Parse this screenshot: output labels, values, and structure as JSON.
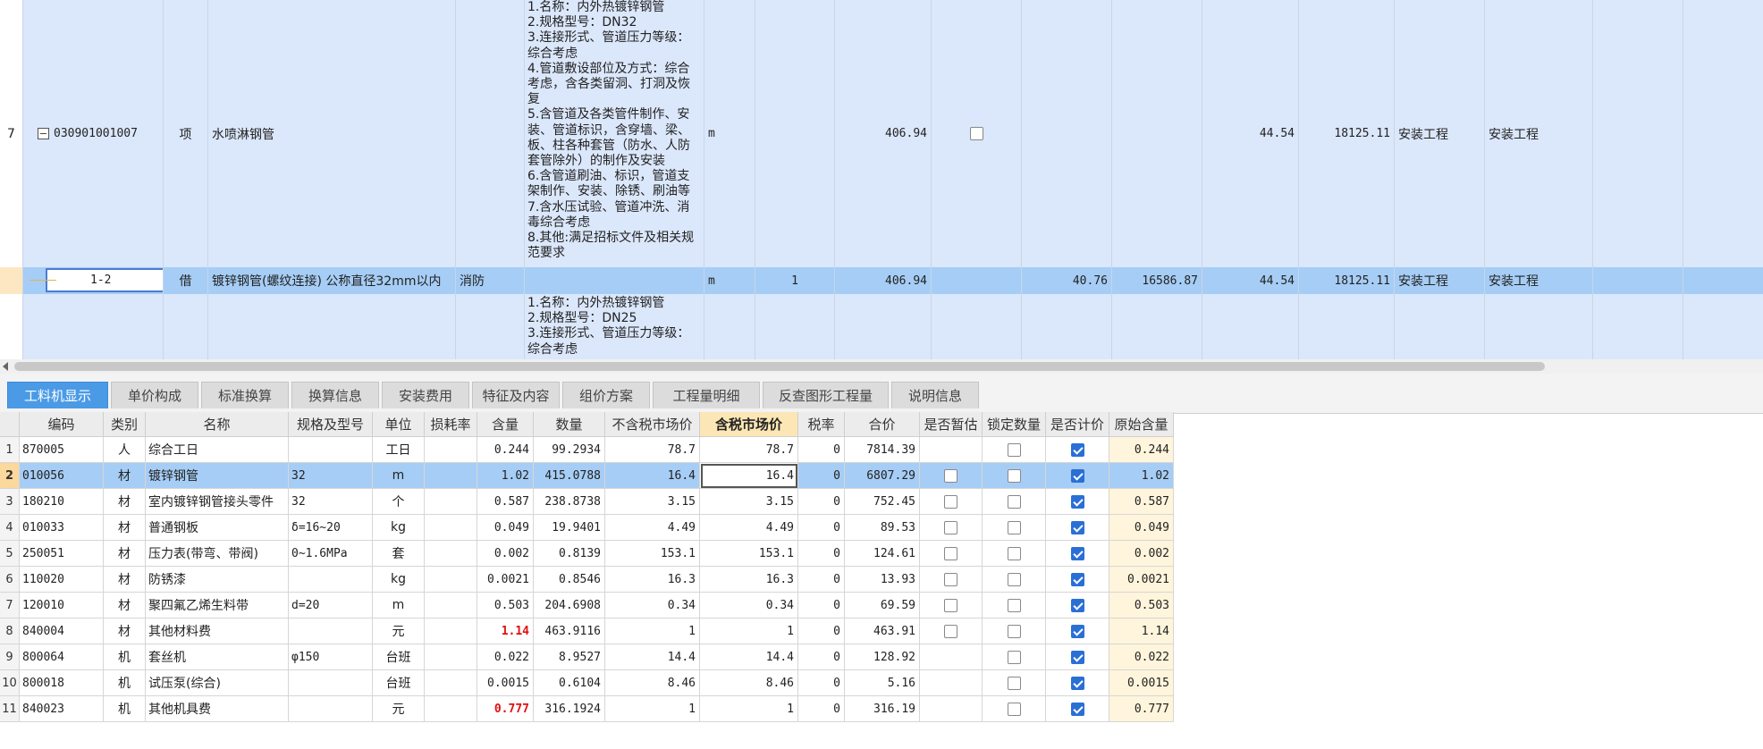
{
  "upper_grid": {
    "rows": [
      {
        "id": "r7",
        "row_number": "7",
        "code": "030901001007",
        "type": "项",
        "name": "水喷淋钢管",
        "specialty": "",
        "description": [
          "1.名称：内外热镀锌钢管",
          "2.规格型号：DN32",
          "3.连接形式、管道压力等级：综合考虑",
          "4.管道敷设部位及方式：综合考虑，含各类留洞、打洞及恢复",
          "5.含管道及各类管件制作、安装、管道标识，含穿墙、梁、板、柱各种套管（防水、人防套管除外）的制作及安装",
          "6.含管道刷油、标识，管道支架制作、安装、除锈、刷油等",
          "7.含水压试验、管道冲洗、消毒综合考虑",
          "8.其他:满足招标文件及相关规范要求"
        ],
        "unit": "m",
        "coef": "",
        "qty": "406.94",
        "checkbox": false,
        "unit_price": "",
        "total": "",
        "unit_price2": "44.54",
        "total2": "18125.11",
        "category1": "安装工程",
        "category2": "安装工程"
      },
      {
        "id": "r12",
        "row_number": "",
        "code": "1-2",
        "type": "借",
        "name": "镀锌钢管(螺纹连接) 公称直径32mm以内",
        "specialty": "消防",
        "description": [],
        "unit": "m",
        "coef": "1",
        "qty": "406.94",
        "unit_price": "40.76",
        "total": "16586.87",
        "unit_price2": "44.54",
        "total2": "18125.11",
        "category1": "安装工程",
        "category2": "安装工程"
      },
      {
        "id": "r8",
        "row_number": "",
        "code": "",
        "type": "",
        "name": "",
        "specialty": "",
        "description": [
          "1.名称：内外热镀锌钢管",
          "2.规格型号：DN25",
          "3.连接形式、管道压力等级：综合考虑"
        ]
      }
    ]
  },
  "tabs": [
    "工料机显示",
    "单价构成",
    "标准换算",
    "换算信息",
    "安装费用",
    "特征及内容",
    "组价方案",
    "工程量明细",
    "反查图形工程量",
    "说明信息"
  ],
  "active_tab": 0,
  "lower_table": {
    "headers": [
      "",
      "编码",
      "类别",
      "名称",
      "规格及型号",
      "单位",
      "损耗率",
      "含量",
      "数量",
      "不含税市场价",
      "含税市场价",
      "税率",
      "合价",
      "是否暂估",
      "锁定数量",
      "是否计价",
      "原始含量"
    ],
    "rows": [
      {
        "n": "1",
        "code": "870005",
        "cat": "人",
        "name": "综合工日",
        "spec": "",
        "unit": "工日",
        "loss": "",
        "content": "0.244",
        "content_red": false,
        "qty": "99.2934",
        "price_ex": "78.7",
        "price_inc": "78.7",
        "tax": "0",
        "total": "7814.39",
        "provisional": null,
        "locked": false,
        "priced": true,
        "orig": "0.244"
      },
      {
        "n": "2",
        "code": "010056",
        "cat": "材",
        "name": "镀锌钢管",
        "spec": "32",
        "unit": "m",
        "loss": "",
        "content": "1.02",
        "content_red": false,
        "qty": "415.0788",
        "price_ex": "16.4",
        "price_inc": "16.4",
        "tax": "0",
        "total": "6807.29",
        "provisional": false,
        "locked": false,
        "priced": true,
        "orig": "1.02",
        "selected": true
      },
      {
        "n": "3",
        "code": "180210",
        "cat": "材",
        "name": "室内镀锌钢管接头零件",
        "spec": "32",
        "unit": "个",
        "loss": "",
        "content": "0.587",
        "content_red": false,
        "qty": "238.8738",
        "price_ex": "3.15",
        "price_inc": "3.15",
        "tax": "0",
        "total": "752.45",
        "provisional": false,
        "locked": false,
        "priced": true,
        "orig": "0.587"
      },
      {
        "n": "4",
        "code": "010033",
        "cat": "材",
        "name": "普通钢板",
        "spec": "δ=16~20",
        "unit": "kg",
        "loss": "",
        "content": "0.049",
        "content_red": false,
        "qty": "19.9401",
        "price_ex": "4.49",
        "price_inc": "4.49",
        "tax": "0",
        "total": "89.53",
        "provisional": false,
        "locked": false,
        "priced": true,
        "orig": "0.049"
      },
      {
        "n": "5",
        "code": "250051",
        "cat": "材",
        "name": "压力表(带弯、带阀)",
        "spec": "0~1.6MPa",
        "unit": "套",
        "loss": "",
        "content": "0.002",
        "content_red": false,
        "qty": "0.8139",
        "price_ex": "153.1",
        "price_inc": "153.1",
        "tax": "0",
        "total": "124.61",
        "provisional": false,
        "locked": false,
        "priced": true,
        "orig": "0.002"
      },
      {
        "n": "6",
        "code": "110020",
        "cat": "材",
        "name": "防锈漆",
        "spec": "",
        "unit": "kg",
        "loss": "",
        "content": "0.0021",
        "content_red": false,
        "qty": "0.8546",
        "price_ex": "16.3",
        "price_inc": "16.3",
        "tax": "0",
        "total": "13.93",
        "provisional": false,
        "locked": false,
        "priced": true,
        "orig": "0.0021"
      },
      {
        "n": "7",
        "code": "120010",
        "cat": "材",
        "name": "聚四氟乙烯生料带",
        "spec": "d=20",
        "unit": "m",
        "loss": "",
        "content": "0.503",
        "content_red": false,
        "qty": "204.6908",
        "price_ex": "0.34",
        "price_inc": "0.34",
        "tax": "0",
        "total": "69.59",
        "provisional": false,
        "locked": false,
        "priced": true,
        "orig": "0.503"
      },
      {
        "n": "8",
        "code": "840004",
        "cat": "材",
        "name": "其他材料费",
        "spec": "",
        "unit": "元",
        "loss": "",
        "content": "1.14",
        "content_red": true,
        "qty": "463.9116",
        "price_ex": "1",
        "price_inc": "1",
        "tax": "0",
        "total": "463.91",
        "provisional": false,
        "locked": false,
        "priced": true,
        "orig": "1.14"
      },
      {
        "n": "9",
        "code": "800064",
        "cat": "机",
        "name": "套丝机",
        "spec": "φ150",
        "unit": "台班",
        "loss": "",
        "content": "0.022",
        "content_red": false,
        "qty": "8.9527",
        "price_ex": "14.4",
        "price_inc": "14.4",
        "tax": "0",
        "total": "128.92",
        "provisional": null,
        "locked": false,
        "priced": true,
        "orig": "0.022"
      },
      {
        "n": "10",
        "code": "800018",
        "cat": "机",
        "name": "试压泵(综合)",
        "spec": "",
        "unit": "台班",
        "loss": "",
        "content": "0.0015",
        "content_red": false,
        "qty": "0.6104",
        "price_ex": "8.46",
        "price_inc": "8.46",
        "tax": "0",
        "total": "5.16",
        "provisional": null,
        "locked": false,
        "priced": true,
        "orig": "0.0015"
      },
      {
        "n": "11",
        "code": "840023",
        "cat": "机",
        "name": "其他机具费",
        "spec": "",
        "unit": "元",
        "loss": "",
        "content": "0.777",
        "content_red": true,
        "qty": "316.1924",
        "price_ex": "1",
        "price_inc": "1",
        "tax": "0",
        "total": "316.19",
        "provisional": null,
        "locked": false,
        "priced": true,
        "orig": "0.777"
      }
    ]
  },
  "colors": {
    "row_bg": "#dbe7fb",
    "selected_bg": "#a6cdf5",
    "active_tab": "#4a9ae6",
    "highlight_header": "#fce6b5",
    "red_value": "#e01010",
    "checkbox_on": "#2a6fd6"
  }
}
